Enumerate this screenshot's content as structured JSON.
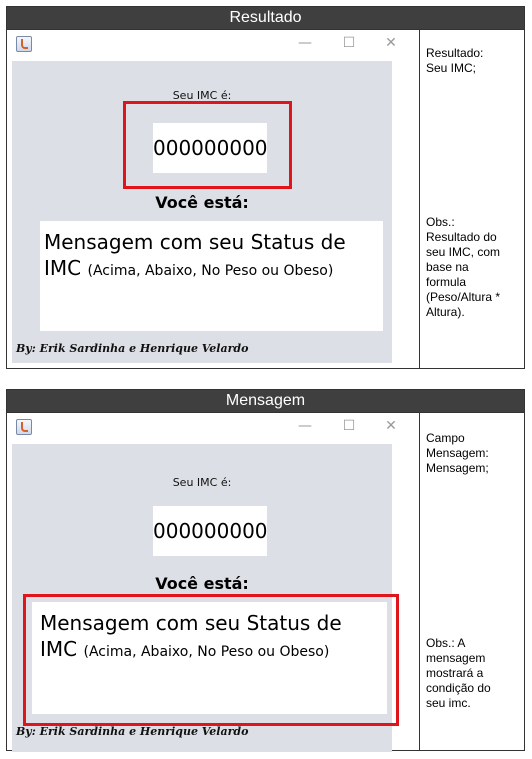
{
  "sections": [
    {
      "header": "Resultado",
      "window": {
        "minimize": "—",
        "maximize": "☐",
        "close": "✕",
        "imc_label": "Seu IMC é:",
        "imc_value": "000000000",
        "status_label": "Você está:",
        "message_line1": "Mensagem com seu Status de",
        "message_line2_main": "IMC",
        "message_line2_paren": "(Acima, Abaixo, No Peso ou Obeso)",
        "credit": "By: Erik Sardinha e Henrique Velardo"
      },
      "side_top": [
        "Resultado:",
        "Seu IMC;"
      ],
      "side_bottom": [
        "Obs.:",
        "Resultado do",
        "seu IMC, com",
        "base na",
        "formula",
        "(Peso/Altura *",
        "Altura)."
      ]
    },
    {
      "header": "Mensagem",
      "window": {
        "minimize": "—",
        "maximize": "☐",
        "close": "✕",
        "imc_label": "Seu IMC é:",
        "imc_value": "000000000",
        "status_label": "Você está:",
        "message_line1": "Mensagem com seu Status de",
        "message_line2_main": "IMC",
        "message_line2_paren": "(Acima, Abaixo, No Peso ou Obeso)",
        "credit": "By: Erik Sardinha e Henrique Velardo"
      },
      "side_top": [
        "Campo",
        "Mensagem:",
        "Mensagem;"
      ],
      "side_bottom": [
        "Obs.: A",
        "mensagem",
        "mostrará a",
        "condição do",
        "seu imc."
      ]
    }
  ],
  "colors": {
    "header_bg": "#3f3f3f",
    "panel_bg": "#dcdfe5",
    "highlight": "#e0141b"
  }
}
